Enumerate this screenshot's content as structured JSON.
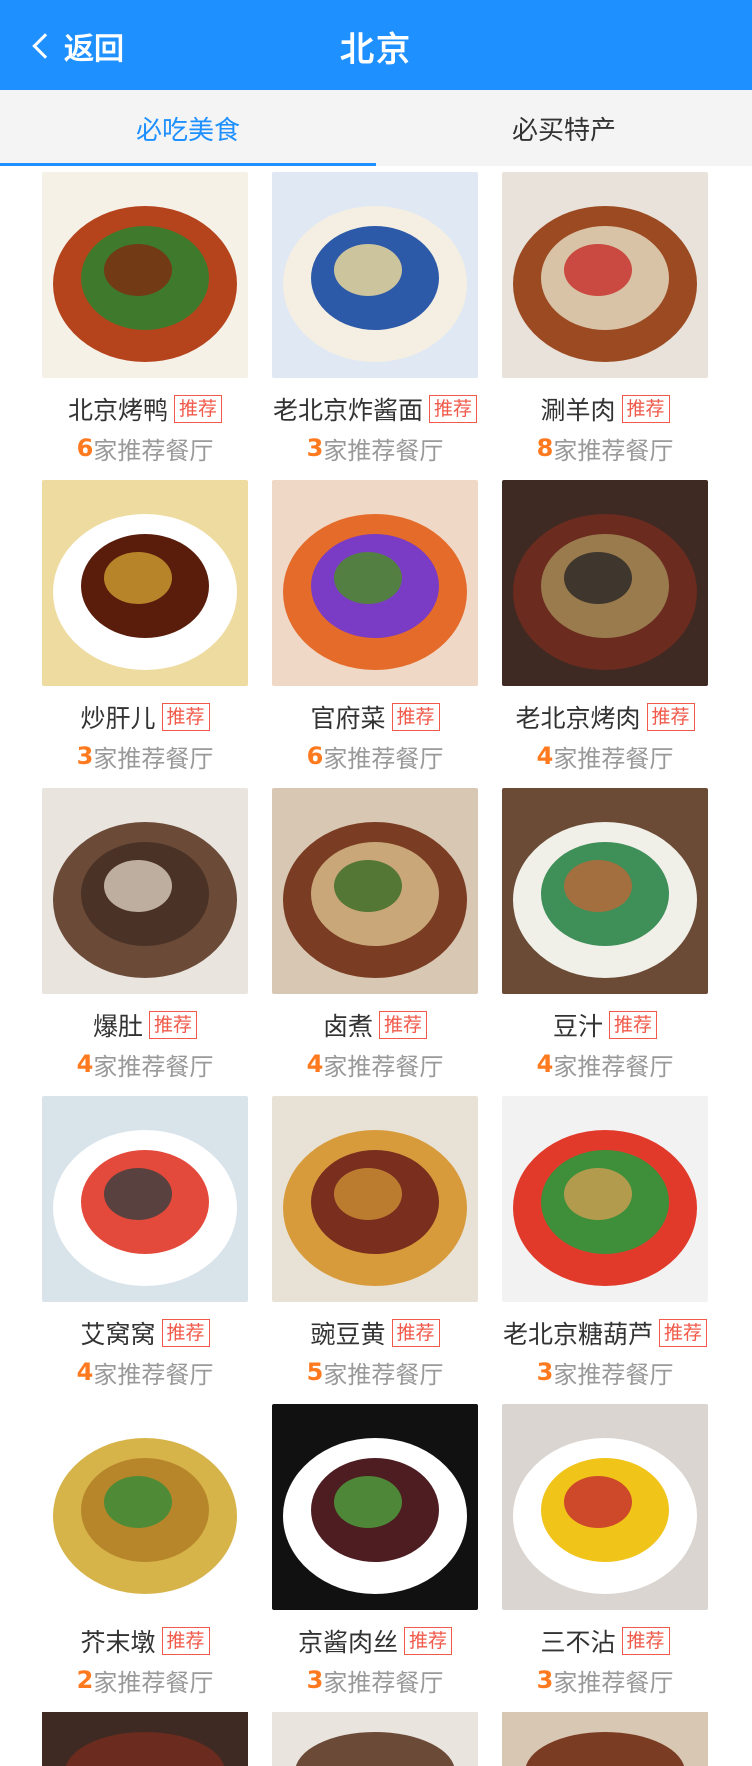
{
  "header": {
    "back_label": "返回",
    "title": "北京"
  },
  "tabs": [
    {
      "label": "必吃美食",
      "active": true
    },
    {
      "label": "必买特产",
      "active": false
    }
  ],
  "badge_text": "推荐",
  "count_suffix": "家推荐餐厅",
  "colors": {
    "header_bg": "#1e90ff",
    "badge": "#f15a4a",
    "count": "#ff7a1e"
  },
  "foods": [
    {
      "name": "北京烤鸭",
      "count": "6"
    },
    {
      "name": "老北京炸酱面",
      "count": "3"
    },
    {
      "name": "涮羊肉",
      "count": "8"
    },
    {
      "name": "炒肝儿",
      "count": "3"
    },
    {
      "name": "官府菜",
      "count": "6"
    },
    {
      "name": "老北京烤肉",
      "count": "4"
    },
    {
      "name": "爆肚",
      "count": "4"
    },
    {
      "name": "卤煮",
      "count": "4"
    },
    {
      "name": "豆汁",
      "count": "4"
    },
    {
      "name": "艾窝窝",
      "count": "4"
    },
    {
      "name": "豌豆黄",
      "count": "5"
    },
    {
      "name": "老北京糖葫芦",
      "count": "3"
    },
    {
      "name": "芥末墩",
      "count": "2"
    },
    {
      "name": "京酱肉丝",
      "count": "3"
    },
    {
      "name": "三不沾",
      "count": "3"
    }
  ]
}
